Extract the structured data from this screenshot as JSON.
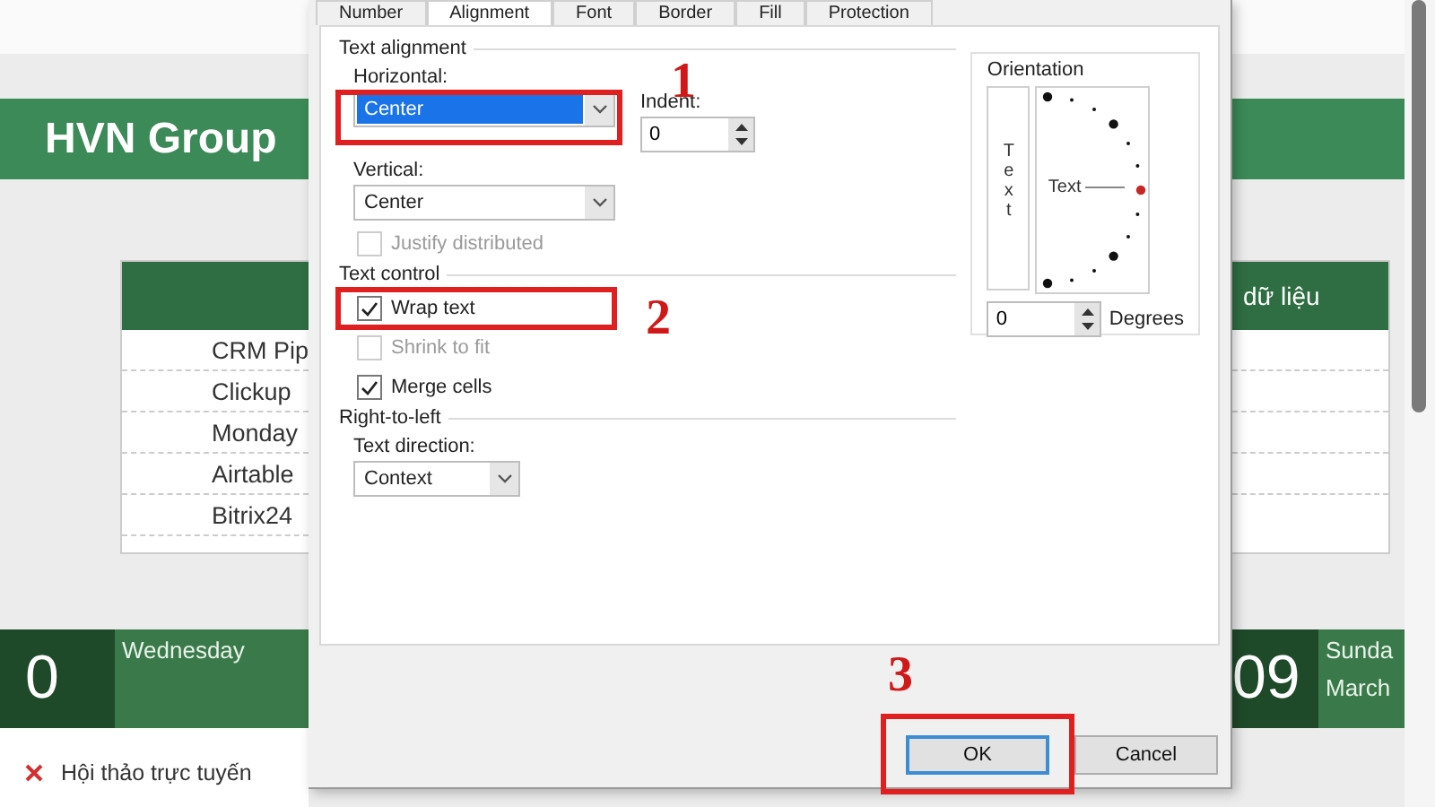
{
  "spreadsheet": {
    "banner_title": "HVN Group",
    "left_card": {
      "rows": [
        "CRM Pip",
        "Clickup",
        "Monday",
        "Airtable",
        "Bitrix24"
      ]
    },
    "right_card": {
      "header": "dữ liệu"
    },
    "left_day": {
      "date": "0",
      "weekday": "Wednesday"
    },
    "right_day": {
      "date": "09",
      "weekday": "Sunda",
      "month": "March"
    },
    "event": {
      "text": "Hội thảo trực tuyến"
    }
  },
  "dialog": {
    "tabs": [
      {
        "label": "Number",
        "selected": false
      },
      {
        "label": "Alignment",
        "selected": true
      },
      {
        "label": "Font",
        "selected": false
      },
      {
        "label": "Border",
        "selected": false
      },
      {
        "label": "Fill",
        "selected": false
      },
      {
        "label": "Protection",
        "selected": false
      }
    ],
    "text_alignment": {
      "title": "Text alignment",
      "horizontal": {
        "label": "Horizontal:",
        "value": "Center",
        "highlighted": true
      },
      "indent": {
        "label": "Indent:",
        "value": "0"
      },
      "vertical": {
        "label": "Vertical:",
        "value": "Center",
        "highlighted": false
      },
      "justify_distributed": {
        "label": "Justify distributed",
        "checked": false,
        "disabled": true
      }
    },
    "text_control": {
      "title": "Text control",
      "options": [
        {
          "label": "Wrap text",
          "checked": true,
          "disabled": false
        },
        {
          "label": "Shrink to fit",
          "checked": false,
          "disabled": true
        },
        {
          "label": "Merge cells",
          "checked": true,
          "disabled": false
        }
      ]
    },
    "right_to_left": {
      "title": "Right-to-left",
      "text_direction": {
        "label": "Text direction:",
        "value": "Context"
      }
    },
    "orientation": {
      "title": "Orientation",
      "vertical_text": "Text",
      "dial_text": "Text",
      "degrees": {
        "value": "0",
        "label": "Degrees"
      }
    },
    "buttons": [
      {
        "label": "OK",
        "default": true
      },
      {
        "label": "Cancel",
        "default": false
      }
    ]
  },
  "annotations": [
    {
      "label": "1"
    },
    {
      "label": "2"
    },
    {
      "label": "3"
    }
  ]
}
